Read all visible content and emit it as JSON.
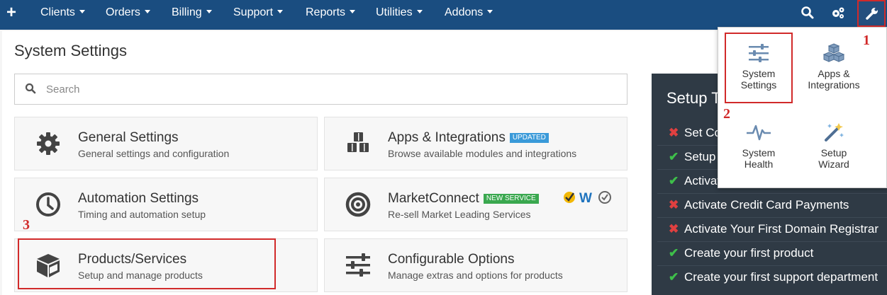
{
  "nav": {
    "plus": "+",
    "items": [
      "Clients",
      "Orders",
      "Billing",
      "Support",
      "Reports",
      "Utilities",
      "Addons"
    ],
    "icons": [
      "search-icon",
      "gears-icon",
      "wrench-icon"
    ]
  },
  "page": {
    "title": "System Settings",
    "search_placeholder": "Search"
  },
  "tiles": [
    {
      "name": "General Settings",
      "desc": "General settings and configuration",
      "icon": "gear-icon"
    },
    {
      "name": "Apps & Integrations",
      "badge": "UPDATED",
      "desc": "Browse available modules and integrations",
      "icon": "cubes-icon"
    },
    {
      "name": "Automation Settings",
      "desc": "Timing and automation setup",
      "icon": "clock-icon"
    },
    {
      "name": "MarketConnect",
      "badge": "NEW SERVICE",
      "desc": "Re-sell Market Leading Services",
      "icon": "bullseye-icon"
    },
    {
      "name": "Products/Services",
      "desc": "Setup and manage products",
      "icon": "cube-icon"
    },
    {
      "name": "Configurable Options",
      "desc": "Manage extras and options for products",
      "icon": "sliders-icon"
    }
  ],
  "setup": {
    "title": "Setup T",
    "tasks": [
      {
        "label": "Set Co",
        "done": false
      },
      {
        "label": "Setup",
        "done": true
      },
      {
        "label": "Activat",
        "done": true
      },
      {
        "label": "Activate Credit Card Payments",
        "done": false
      },
      {
        "label": "Activate Your First Domain Registrar",
        "done": false
      },
      {
        "label": "Create your first product",
        "done": true
      },
      {
        "label": "Create your first support department",
        "done": true
      }
    ]
  },
  "dropdown": {
    "items": [
      {
        "line1": "System",
        "line2": "Settings",
        "icon": "sliders-icon"
      },
      {
        "line1": "Apps &",
        "line2": "Integrations",
        "icon": "cubes-icon"
      },
      {
        "line1": "System",
        "line2": "Health",
        "icon": "pulse-icon"
      },
      {
        "line1": "Setup",
        "line2": "Wizard",
        "icon": "magic-wand-icon"
      }
    ]
  },
  "annotations": [
    "1",
    "2",
    "3"
  ],
  "colors": {
    "nav_bg": "#1a4d80",
    "highlight": "#d12a2a",
    "badge_updated": "#3a9ad9",
    "badge_new": "#3aa84f",
    "setup_bg": "#2f3a45"
  }
}
